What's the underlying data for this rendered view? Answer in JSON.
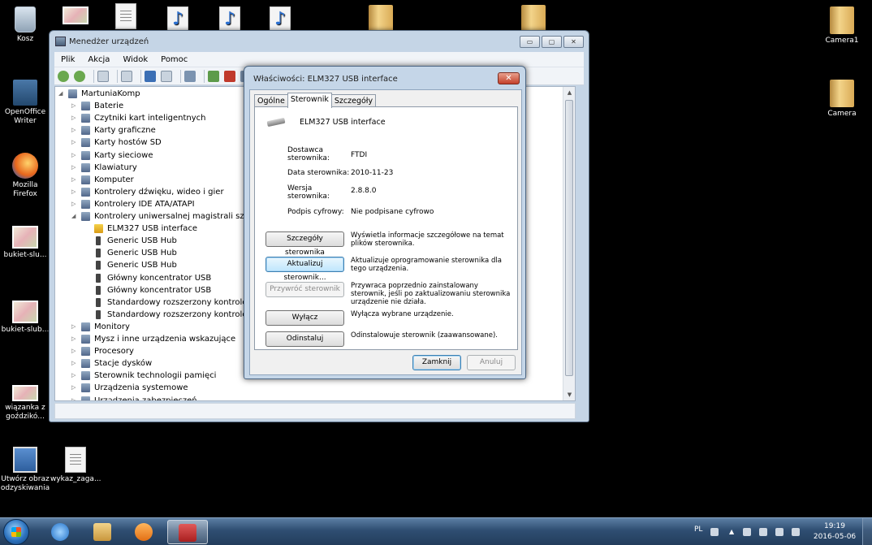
{
  "desktop": {
    "icons": [
      {
        "label": "Kosz",
        "icon": "recycle-bin-icon"
      },
      {
        "label": "OpenOffice Writer",
        "icon": "openoffice-writer-icon"
      },
      {
        "label": "Mozilla Firefox",
        "icon": "firefox-icon"
      },
      {
        "label": "bukiet-slu...",
        "icon": "photo-icon"
      },
      {
        "label": "bukiet-slub...",
        "icon": "photo-icon"
      },
      {
        "label": "wiązanka z goździkó...",
        "icon": "photo-icon"
      },
      {
        "label": "Utwórz obraz odzyskiwania",
        "icon": "recovery-image-icon"
      },
      {
        "label": "wykaz_zaga...",
        "icon": "document-icon"
      },
      {
        "label": "Camera1",
        "icon": "folder-icon"
      },
      {
        "label": "Camera",
        "icon": "folder-icon"
      }
    ]
  },
  "device_manager": {
    "title": "Menedżer urządzeń",
    "window_buttons": {
      "minimize": "▭",
      "maximize": "▢",
      "close": "✕"
    },
    "menu": [
      "Plik",
      "Akcja",
      "Widok",
      "Pomoc"
    ],
    "tree": {
      "root": "MartuniaKomp",
      "categories": [
        "Baterie",
        "Czytniki kart inteligentnych",
        "Karty graficzne",
        "Karty hostów SD",
        "Karty sieciowe",
        "Klawiatury",
        "Komputer",
        "Kontrolery dźwięku, wideo i gier",
        "Kontrolery IDE ATA/ATAPI",
        "Kontrolery uniwersalnej magistrali szeregowej"
      ],
      "usb_children": [
        "ELM327 USB interface",
        "Generic USB Hub",
        "Generic USB Hub",
        "Generic USB Hub",
        "Główny koncentrator USB",
        "Główny koncentrator USB",
        "Standardowy rozszerzony kontroler hosta",
        "Standardowy rozszerzony kontroler hosta"
      ],
      "more_categories": [
        "Monitory",
        "Mysz i inne urządzenia wskazujące",
        "Procesory",
        "Stacje dysków",
        "Sterownik technologii pamięci",
        "Urządzenia systemowe",
        "Urządzenia zabezpieczeń"
      ]
    }
  },
  "properties": {
    "title": "Właściwości: ELM327 USB interface",
    "close_glyph": "✕",
    "tabs": [
      "Ogólne",
      "Sterownik",
      "Szczegóły"
    ],
    "active_tab": "Sterownik",
    "device_name": "ELM327 USB interface",
    "fields": [
      {
        "label": "Dostawca sterownika:",
        "value": "FTDI"
      },
      {
        "label": "Data sterownika:",
        "value": "2010-11-23"
      },
      {
        "label": "Wersja sterownika:",
        "value": "2.8.8.0"
      },
      {
        "label": "Podpis cyfrowy:",
        "value": "Nie podpisane cyfrowo"
      }
    ],
    "actions": [
      {
        "button": "Szczegóły sterownika",
        "description": "Wyświetla informacje szczegółowe na temat plików sterownika.",
        "state": "normal"
      },
      {
        "button": "Aktualizuj sterownik...",
        "description": "Aktualizuje oprogramowanie sterownika dla tego urządzenia.",
        "state": "focused"
      },
      {
        "button": "Przywróć sterownik",
        "description": "Przywraca poprzednio zainstalowany sterownik, jeśli po zaktualizowaniu sterownika urządzenie nie działa.",
        "state": "disabled"
      },
      {
        "button": "Wyłącz",
        "description": "Wyłącza wybrane urządzenie.",
        "state": "normal"
      },
      {
        "button": "Odinstaluj",
        "description": "Odinstalowuje sterownik (zaawansowane).",
        "state": "normal"
      }
    ],
    "ok_label": "Zamknij",
    "cancel_label": "Anuluj"
  },
  "taskbar": {
    "language": "PL",
    "time": "19:19",
    "date": "2016-05-06",
    "pinned": [
      "internet-explorer-icon",
      "explorer-icon",
      "media-player-icon",
      "device-manager-icon"
    ]
  }
}
